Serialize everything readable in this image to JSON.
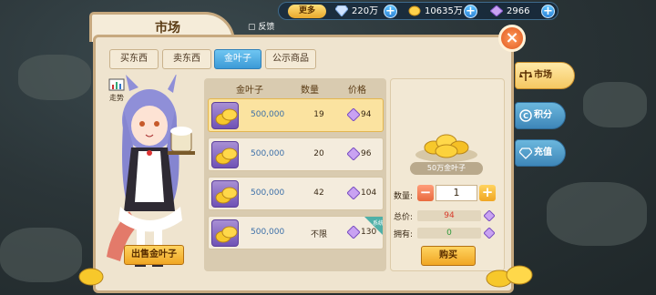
{
  "topbar": {
    "more_label": "更多",
    "currencies": [
      {
        "icon": "diamond-icon",
        "value": "220万"
      },
      {
        "icon": "gold-leaf-icon",
        "value": "10635万"
      },
      {
        "icon": "purple-gem-icon",
        "value": "2966"
      }
    ]
  },
  "panel": {
    "title": "市场",
    "feedback_label": "反馈",
    "close_symbol": "×",
    "tabs": [
      {
        "label": "买东西",
        "active": false
      },
      {
        "label": "卖东西",
        "active": false
      },
      {
        "label": "金叶子",
        "active": true
      },
      {
        "label": "公示商品",
        "active": false
      }
    ]
  },
  "trend_label": "走势",
  "sell_button_label": "出售金叶子",
  "list": {
    "headers": [
      "金叶子",
      "数量",
      "价格"
    ],
    "rows": [
      {
        "amount": "500,000",
        "qty": "19",
        "price": "94",
        "selected": true,
        "tag": false
      },
      {
        "amount": "500,000",
        "qty": "20",
        "price": "96",
        "selected": false,
        "tag": false
      },
      {
        "amount": "500,000",
        "qty": "42",
        "price": "104",
        "selected": false,
        "tag": false
      },
      {
        "amount": "500,000",
        "qty": "不限",
        "price": "130",
        "selected": false,
        "tag": true,
        "tag_text": "系统"
      }
    ]
  },
  "detail": {
    "item_label": "50万金叶子",
    "qty_label": "数量:",
    "qty_value": "1",
    "minus_symbol": "−",
    "plus_symbol": "+",
    "total_label": "总价:",
    "total_value": "94",
    "own_label": "拥有:",
    "own_value": "0",
    "buy_label": "购买"
  },
  "side_tabs": [
    {
      "label": "市场",
      "icon": "scale-icon"
    },
    {
      "label": "积分",
      "icon": "points-icon"
    },
    {
      "label": "充值",
      "icon": "gem-icon"
    }
  ],
  "colors": {
    "accent_gold": "#f0a623",
    "active_tab": "#3c9ad6",
    "price_red": "#d83a2a",
    "own_green": "#2f9a3a"
  }
}
